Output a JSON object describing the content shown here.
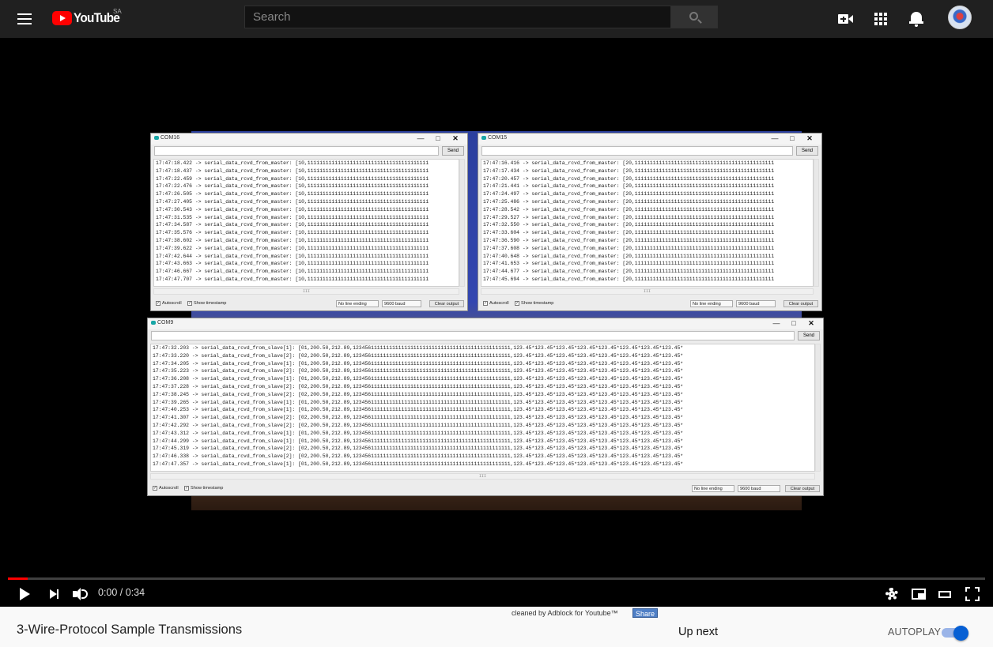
{
  "header": {
    "logo_text": "YouTube",
    "country_code": "SA",
    "search_placeholder": "Search"
  },
  "video": {
    "windows": [
      {
        "title": "COM16",
        "send_label": "Send",
        "lines": [
          "17:47:18.422 -> serial_data_rcvd_from_master: [10,1111111111111111111111111111111111111111",
          "17:47:18.437 -> serial_data_rcvd_from_master: [10,1111111111111111111111111111111111111111",
          "17:47:22.459 -> serial_data_rcvd_from_master: [10,1111111111111111111111111111111111111111",
          "17:47:22.476 -> serial_data_rcvd_from_master: [10,1111111111111111111111111111111111111111",
          "17:47:26.505 -> serial_data_rcvd_from_master: [10,1111111111111111111111111111111111111111",
          "17:47:27.405 -> serial_data_rcvd_from_master: [10,1111111111111111111111111111111111111111",
          "17:47:30.543 -> serial_data_rcvd_from_master: [10,1111111111111111111111111111111111111111",
          "17:47:31.535 -> serial_data_rcvd_from_master: [10,1111111111111111111111111111111111111111",
          "17:47:34.587 -> serial_data_rcvd_from_master: [10,1111111111111111111111111111111111111111",
          "17:47:35.576 -> serial_data_rcvd_from_master: [10,1111111111111111111111111111111111111111",
          "17:47:38.602 -> serial_data_rcvd_from_master: [10,1111111111111111111111111111111111111111",
          "17:47:39.622 -> serial_data_rcvd_from_master: [10,1111111111111111111111111111111111111111",
          "17:47:42.644 -> serial_data_rcvd_from_master: [10,1111111111111111111111111111111111111111",
          "17:47:43.663 -> serial_data_rcvd_from_master: [10,1111111111111111111111111111111111111111",
          "17:47:46.667 -> serial_data_rcvd_from_master: [10,1111111111111111111111111111111111111111",
          "17:47:47.707 -> serial_data_rcvd_from_master: [10,1111111111111111111111111111111111111111"
        ],
        "autoscroll_label": "Autoscroll",
        "timestamp_label": "Show timestamp",
        "line_ending": "No line ending",
        "baud": "9600 baud",
        "clear_label": "Clear output"
      },
      {
        "title": "COM15",
        "send_label": "Send",
        "lines": [
          "17:47:16.416 -> serial_data_rcvd_from_master: [20,1111111111111111111111111111111111111111111111",
          "17:47:17.434 -> serial_data_rcvd_from_master: [20,1111111111111111111111111111111111111111111111",
          "17:47:20.457 -> serial_data_rcvd_from_master: [20,1111111111111111111111111111111111111111111111",
          "17:47:21.441 -> serial_data_rcvd_from_master: [20,1111111111111111111111111111111111111111111111",
          "17:47:24.497 -> serial_data_rcvd_from_master: [20,1111111111111111111111111111111111111111111111",
          "17:47:25.486 -> serial_data_rcvd_from_master: [20,1111111111111111111111111111111111111111111111",
          "17:47:28.542 -> serial_data_rcvd_from_master: [20,1111111111111111111111111111111111111111111111",
          "17:47:29.527 -> serial_data_rcvd_from_master: [20,1111111111111111111111111111111111111111111111",
          "17:47:32.550 -> serial_data_rcvd_from_master: [20,1111111111111111111111111111111111111111111111",
          "17:47:33.604 -> serial_data_rcvd_from_master: [20,1111111111111111111111111111111111111111111111",
          "17:47:36.590 -> serial_data_rcvd_from_master: [20,1111111111111111111111111111111111111111111111",
          "17:47:37.608 -> serial_data_rcvd_from_master: [20,1111111111111111111111111111111111111111111111",
          "17:47:40.648 -> serial_data_rcvd_from_master: [20,1111111111111111111111111111111111111111111111",
          "17:47:41.653 -> serial_data_rcvd_from_master: [20,1111111111111111111111111111111111111111111111",
          "17:47:44.677 -> serial_data_rcvd_from_master: [20,1111111111111111111111111111111111111111111111",
          "17:47:45.694 -> serial_data_rcvd_from_master: [20,1111111111111111111111111111111111111111111111"
        ],
        "autoscroll_label": "Autoscroll",
        "timestamp_label": "Show timestamp",
        "line_ending": "No line ending",
        "baud": "9600 baud",
        "clear_label": "Clear output"
      },
      {
        "title": "COM9",
        "send_label": "Send",
        "lines": [
          "17:47:32.203 -> serial_data_rcvd_from_slave[1]: [01,200.50,212.89,1234561111111111111111111111111111111111111111111111,123.45*123.45*123.45*123.45*123.45*123.45*123.45*123.45*",
          "17:47:33.220 -> serial_data_rcvd_from_slave[2]: [02,200.50,212.89,1234561111111111111111111111111111111111111111111111,123.45*123.45*123.45*123.45*123.45*123.45*123.45*123.45*",
          "17:47:34.205 -> serial_data_rcvd_from_slave[1]: [01,200.50,212.89,1234561111111111111111111111111111111111111111111111,123.45*123.45*123.45*123.45*123.45*123.45*123.45*123.45*",
          "17:47:35.223 -> serial_data_rcvd_from_slave[2]: [02,200.50,212.89,1234561111111111111111111111111111111111111111111111,123.45*123.45*123.45*123.45*123.45*123.45*123.45*123.45*",
          "17:47:36.208 -> serial_data_rcvd_from_slave[1]: [01,200.50,212.89,1234561111111111111111111111111111111111111111111111,123.45*123.45*123.45*123.45*123.45*123.45*123.45*123.45*",
          "17:47:37.228 -> serial_data_rcvd_from_slave[2]: [02,200.50,212.89,1234561111111111111111111111111111111111111111111111,123.45*123.45*123.45*123.45*123.45*123.45*123.45*123.45*",
          "17:47:38.245 -> serial_data_rcvd_from_slave[2]: [02,200.50,212.89,1234561111111111111111111111111111111111111111111111,123.45*123.45*123.45*123.45*123.45*123.45*123.45*123.45*",
          "17:47:39.265 -> serial_data_rcvd_from_slave[1]: [01,200.50,212.89,1234561111111111111111111111111111111111111111111111,123.45*123.45*123.45*123.45*123.45*123.45*123.45*123.45*",
          "17:47:40.253 -> serial_data_rcvd_from_slave[1]: [01,200.50,212.89,1234561111111111111111111111111111111111111111111111,123.45*123.45*123.45*123.45*123.45*123.45*123.45*123.45*",
          "17:47:41.307 -> serial_data_rcvd_from_slave[2]: [02,200.50,212.89,1234561111111111111111111111111111111111111111111111,123.45*123.45*123.45*123.45*123.45*123.45*123.45*123.45*",
          "17:47:42.292 -> serial_data_rcvd_from_slave[2]: [02,200.50,212.89,1234561111111111111111111111111111111111111111111111,123.45*123.45*123.45*123.45*123.45*123.45*123.45*123.45*",
          "17:47:43.312 -> serial_data_rcvd_from_slave[1]: [01,200.50,212.89,1234561111111111111111111111111111111111111111111111,123.45*123.45*123.45*123.45*123.45*123.45*123.45*123.45*",
          "17:47:44.299 -> serial_data_rcvd_from_slave[1]: [01,200.50,212.89,1234561111111111111111111111111111111111111111111111,123.45*123.45*123.45*123.45*123.45*123.45*123.45*123.45*",
          "17:47:45.319 -> serial_data_rcvd_from_slave[2]: [02,200.50,212.89,1234561111111111111111111111111111111111111111111111,123.45*123.45*123.45*123.45*123.45*123.45*123.45*123.45*",
          "17:47:46.338 -> serial_data_rcvd_from_slave[2]: [02,200.50,212.89,1234561111111111111111111111111111111111111111111111,123.45*123.45*123.45*123.45*123.45*123.45*123.45*123.45*",
          "17:47:47.357 -> serial_data_rcvd_from_slave[1]: [01,200.50,212.89,1234561111111111111111111111111111111111111111111111,123.45*123.45*123.45*123.45*123.45*123.45*123.45*123.45*"
        ],
        "autoscroll_label": "Autoscroll",
        "timestamp_label": "Show timestamp",
        "line_ending": "No line ending",
        "baud": "9600 baud",
        "clear_label": "Clear output"
      }
    ]
  },
  "controls": {
    "time_display": "0:00 / 0:34",
    "progress_fraction": 0.02
  },
  "below": {
    "adblock_note": "cleaned by Adblock for Youtube™",
    "share_label": "Share",
    "video_title": "3-Wire-Protocol Sample Transmissions",
    "up_next": "Up next",
    "autoplay_label": "AUTOPLAY",
    "autoplay_on": true
  },
  "colors": {
    "brand_red": "#ff0000",
    "masthead": "#202020",
    "toggle_blue": "#065fd4"
  }
}
